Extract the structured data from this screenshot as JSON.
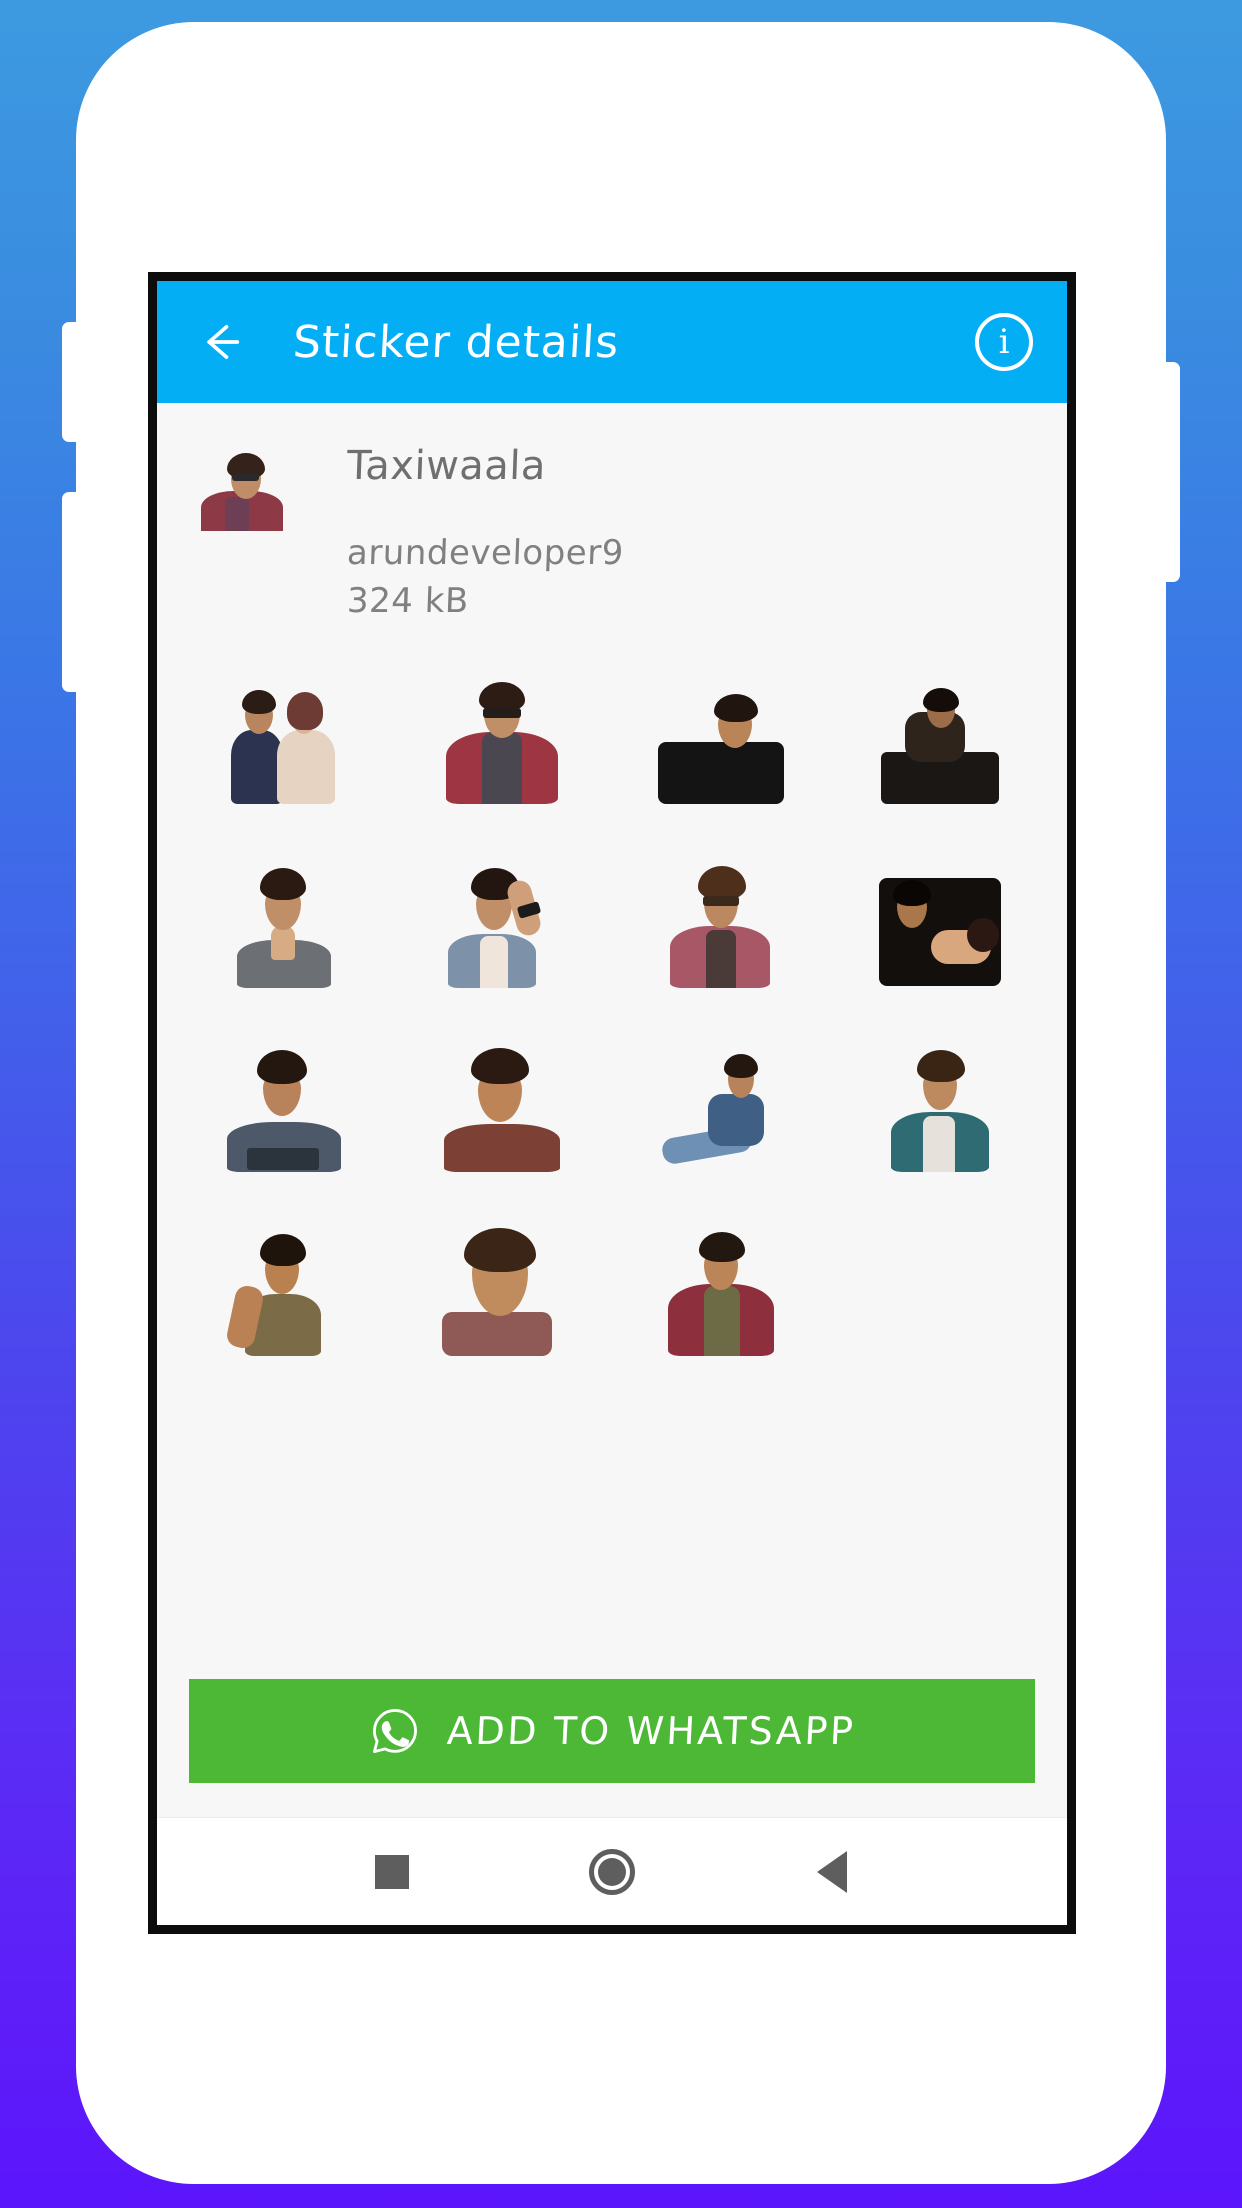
{
  "appbar": {
    "back_icon": "arrow-left-icon",
    "title": "Sticker details",
    "info_icon": "info-icon",
    "info_glyph": "i",
    "background_color": "#03AEF5",
    "text_color": "#FFFFFF"
  },
  "pack": {
    "title": "Taxiwaala",
    "author": "arundeveloper9",
    "size": "324 kB",
    "tray_icon": "sticker-tray-thumbnail"
  },
  "stickers": [
    {
      "id": 1,
      "label": "couple-embrace-sticker"
    },
    {
      "id": 2,
      "label": "red-jacket-sunglasses-sticker"
    },
    {
      "id": 3,
      "label": "dark-coat-lean-sticker"
    },
    {
      "id": 4,
      "label": "seated-dark-sticker"
    },
    {
      "id": 5,
      "label": "namaste-grey-shirt-sticker"
    },
    {
      "id": 6,
      "label": "hand-on-head-denim-sticker"
    },
    {
      "id": 7,
      "label": "pink-jacket-sunglasses-sticker"
    },
    {
      "id": 8,
      "label": "couple-dark-sticker"
    },
    {
      "id": 9,
      "label": "roadster-tshirt-sticker"
    },
    {
      "id": 10,
      "label": "brown-jacket-portrait-sticker"
    },
    {
      "id": 11,
      "label": "sitting-jeans-sticker"
    },
    {
      "id": 12,
      "label": "teal-jacket-sticker"
    },
    {
      "id": 13,
      "label": "sleeveless-vest-sticker"
    },
    {
      "id": 14,
      "label": "smiling-closeup-sticker"
    },
    {
      "id": 15,
      "label": "red-jacket-olive-tee-sticker"
    }
  ],
  "cta": {
    "label": "ADD TO WHATSAPP",
    "icon": "whatsapp-icon",
    "background_color": "#4CB836",
    "text_color": "#FFFFFF"
  },
  "navbar": {
    "recents": "square-recents-icon",
    "home": "circle-home-icon",
    "back": "triangle-back-icon"
  },
  "background": {
    "gradient_from": "#3D9AE0",
    "gradient_to": "#5C15FB"
  }
}
